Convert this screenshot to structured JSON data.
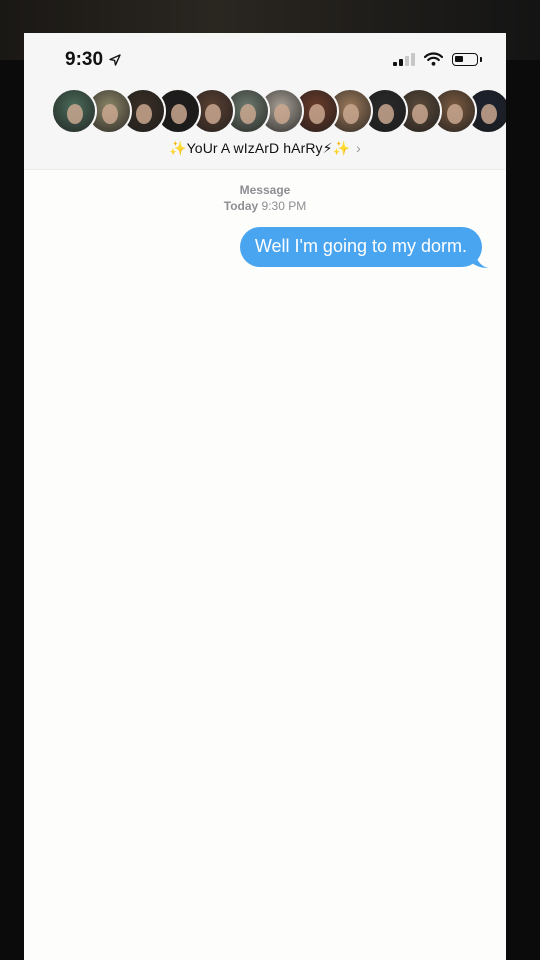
{
  "status_bar": {
    "time": "9:30",
    "signal_bars": 2,
    "battery_level": 0.4
  },
  "conversation": {
    "group_name": "✨YoUr A wIzArD hArRy⚡✨",
    "participant_count_visible": 13,
    "avatar_colors": [
      "#4b6b5a",
      "#8c8568",
      "#3a2f25",
      "#1f1d1c",
      "#5a4032",
      "#6d7a6e",
      "#a8a196",
      "#6a3b2a",
      "#9c7a5b",
      "#2b2a2a",
      "#5b4a3a",
      "#7a5a40",
      "#1d2230"
    ]
  },
  "thread": {
    "service_label": "Message",
    "day_label": "Today",
    "time_label": "9:30 PM",
    "messages": [
      {
        "direction": "outgoing",
        "text": "Well I'm going to my dorm."
      }
    ]
  },
  "colors": {
    "bubble_blue": "#4aa5f0",
    "header_bg": "#f6f6f6",
    "screen_bg": "#fdfdfc"
  },
  "icons": {
    "location": "location-arrow-icon",
    "wifi": "wifi-icon",
    "battery": "battery-icon",
    "signal": "cellular-signal-icon",
    "chevron": "chevron-right-icon"
  }
}
